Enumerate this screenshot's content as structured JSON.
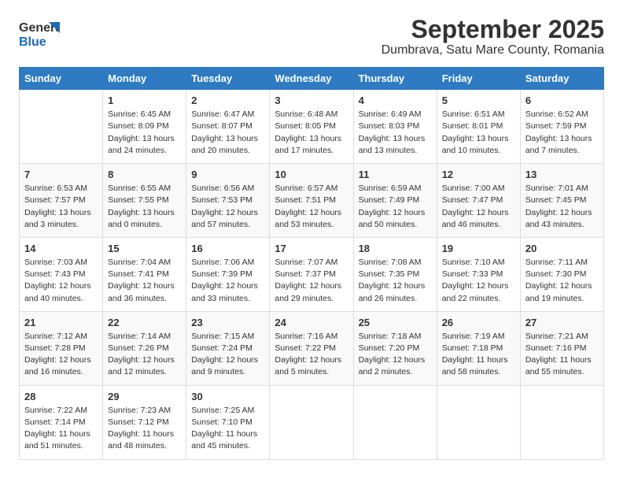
{
  "logo": {
    "line1": "General",
    "line2": "Blue"
  },
  "title": "September 2025",
  "subtitle": "Dumbrava, Satu Mare County, Romania",
  "weekdays": [
    "Sunday",
    "Monday",
    "Tuesday",
    "Wednesday",
    "Thursday",
    "Friday",
    "Saturday"
  ],
  "weeks": [
    [
      {
        "day": "",
        "info": ""
      },
      {
        "day": "1",
        "info": "Sunrise: 6:45 AM\nSunset: 8:09 PM\nDaylight: 13 hours\nand 24 minutes."
      },
      {
        "day": "2",
        "info": "Sunrise: 6:47 AM\nSunset: 8:07 PM\nDaylight: 13 hours\nand 20 minutes."
      },
      {
        "day": "3",
        "info": "Sunrise: 6:48 AM\nSunset: 8:05 PM\nDaylight: 13 hours\nand 17 minutes."
      },
      {
        "day": "4",
        "info": "Sunrise: 6:49 AM\nSunset: 8:03 PM\nDaylight: 13 hours\nand 13 minutes."
      },
      {
        "day": "5",
        "info": "Sunrise: 6:51 AM\nSunset: 8:01 PM\nDaylight: 13 hours\nand 10 minutes."
      },
      {
        "day": "6",
        "info": "Sunrise: 6:52 AM\nSunset: 7:59 PM\nDaylight: 13 hours\nand 7 minutes."
      }
    ],
    [
      {
        "day": "7",
        "info": "Sunrise: 6:53 AM\nSunset: 7:57 PM\nDaylight: 13 hours\nand 3 minutes."
      },
      {
        "day": "8",
        "info": "Sunrise: 6:55 AM\nSunset: 7:55 PM\nDaylight: 13 hours\nand 0 minutes."
      },
      {
        "day": "9",
        "info": "Sunrise: 6:56 AM\nSunset: 7:53 PM\nDaylight: 12 hours\nand 57 minutes."
      },
      {
        "day": "10",
        "info": "Sunrise: 6:57 AM\nSunset: 7:51 PM\nDaylight: 12 hours\nand 53 minutes."
      },
      {
        "day": "11",
        "info": "Sunrise: 6:59 AM\nSunset: 7:49 PM\nDaylight: 12 hours\nand 50 minutes."
      },
      {
        "day": "12",
        "info": "Sunrise: 7:00 AM\nSunset: 7:47 PM\nDaylight: 12 hours\nand 46 minutes."
      },
      {
        "day": "13",
        "info": "Sunrise: 7:01 AM\nSunset: 7:45 PM\nDaylight: 12 hours\nand 43 minutes."
      }
    ],
    [
      {
        "day": "14",
        "info": "Sunrise: 7:03 AM\nSunset: 7:43 PM\nDaylight: 12 hours\nand 40 minutes."
      },
      {
        "day": "15",
        "info": "Sunrise: 7:04 AM\nSunset: 7:41 PM\nDaylight: 12 hours\nand 36 minutes."
      },
      {
        "day": "16",
        "info": "Sunrise: 7:06 AM\nSunset: 7:39 PM\nDaylight: 12 hours\nand 33 minutes."
      },
      {
        "day": "17",
        "info": "Sunrise: 7:07 AM\nSunset: 7:37 PM\nDaylight: 12 hours\nand 29 minutes."
      },
      {
        "day": "18",
        "info": "Sunrise: 7:08 AM\nSunset: 7:35 PM\nDaylight: 12 hours\nand 26 minutes."
      },
      {
        "day": "19",
        "info": "Sunrise: 7:10 AM\nSunset: 7:33 PM\nDaylight: 12 hours\nand 22 minutes."
      },
      {
        "day": "20",
        "info": "Sunrise: 7:11 AM\nSunset: 7:30 PM\nDaylight: 12 hours\nand 19 minutes."
      }
    ],
    [
      {
        "day": "21",
        "info": "Sunrise: 7:12 AM\nSunset: 7:28 PM\nDaylight: 12 hours\nand 16 minutes."
      },
      {
        "day": "22",
        "info": "Sunrise: 7:14 AM\nSunset: 7:26 PM\nDaylight: 12 hours\nand 12 minutes."
      },
      {
        "day": "23",
        "info": "Sunrise: 7:15 AM\nSunset: 7:24 PM\nDaylight: 12 hours\nand 9 minutes."
      },
      {
        "day": "24",
        "info": "Sunrise: 7:16 AM\nSunset: 7:22 PM\nDaylight: 12 hours\nand 5 minutes."
      },
      {
        "day": "25",
        "info": "Sunrise: 7:18 AM\nSunset: 7:20 PM\nDaylight: 12 hours\nand 2 minutes."
      },
      {
        "day": "26",
        "info": "Sunrise: 7:19 AM\nSunset: 7:18 PM\nDaylight: 11 hours\nand 58 minutes."
      },
      {
        "day": "27",
        "info": "Sunrise: 7:21 AM\nSunset: 7:16 PM\nDaylight: 11 hours\nand 55 minutes."
      }
    ],
    [
      {
        "day": "28",
        "info": "Sunrise: 7:22 AM\nSunset: 7:14 PM\nDaylight: 11 hours\nand 51 minutes."
      },
      {
        "day": "29",
        "info": "Sunrise: 7:23 AM\nSunset: 7:12 PM\nDaylight: 11 hours\nand 48 minutes."
      },
      {
        "day": "30",
        "info": "Sunrise: 7:25 AM\nSunset: 7:10 PM\nDaylight: 11 hours\nand 45 minutes."
      },
      {
        "day": "",
        "info": ""
      },
      {
        "day": "",
        "info": ""
      },
      {
        "day": "",
        "info": ""
      },
      {
        "day": "",
        "info": ""
      }
    ]
  ]
}
